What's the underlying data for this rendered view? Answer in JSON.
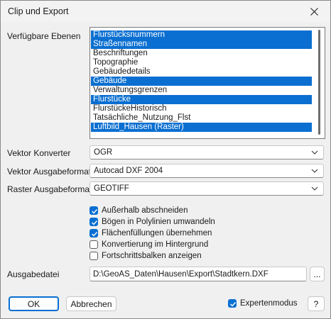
{
  "window": {
    "title": "Clip und Export"
  },
  "layers": {
    "label": "Verfügbare Ebenen",
    "items": [
      {
        "label": "Flurstücksnummern",
        "selected": true
      },
      {
        "label": "Straßennamen",
        "selected": true
      },
      {
        "label": "Beschriftungen",
        "selected": false
      },
      {
        "label": "Topographie",
        "selected": false
      },
      {
        "label": "Gebäudedetails",
        "selected": false
      },
      {
        "label": "Gebäude",
        "selected": true
      },
      {
        "label": "Verwaltungsgrenzen",
        "selected": false
      },
      {
        "label": "Flurstücke",
        "selected": true
      },
      {
        "label": "FlurstückeHistorisch",
        "selected": false
      },
      {
        "label": "Tatsächliche_Nutzung_Flst",
        "selected": false
      },
      {
        "label": "Luftbild_Hausen (Raster)",
        "selected": true
      }
    ]
  },
  "vector_converter": {
    "label": "Vektor Konverter",
    "value": "OGR"
  },
  "vector_format": {
    "label": "Vektor Ausgabeformat",
    "value": "Autocad DXF 2004"
  },
  "raster_format": {
    "label": "Raster Ausgabeformat",
    "value": "GEOTIFF"
  },
  "options": [
    {
      "label": "Außerhalb abschneiden",
      "checked": true
    },
    {
      "label": "Bögen in Polylinien umwandeln",
      "checked": true
    },
    {
      "label": "Flächenfüllungen übernehmen",
      "checked": true
    },
    {
      "label": "Konvertierung im Hintergrund",
      "checked": false
    },
    {
      "label": "Fortschrittsbalken anzeigen",
      "checked": false
    }
  ],
  "output_file": {
    "label": "Ausgabedatei",
    "value": "D:\\GeoAS_Daten\\Hausen\\Export\\Stadtkern.DXF",
    "browse_label": "..."
  },
  "buttons": {
    "ok": "OK",
    "cancel": "Abbrechen",
    "help": "?"
  },
  "expert_mode": {
    "label": "Expertenmodus",
    "checked": true
  },
  "colors": {
    "accent": "#0a6fd1"
  }
}
